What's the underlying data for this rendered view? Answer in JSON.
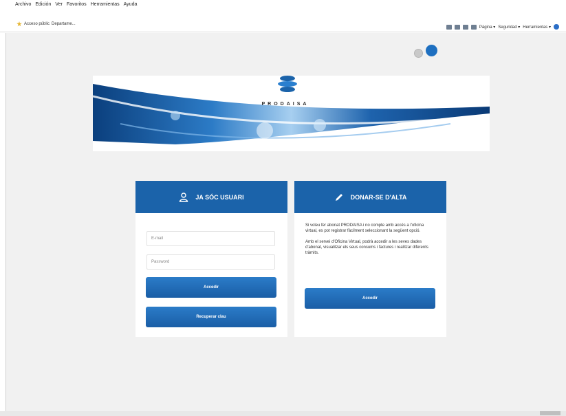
{
  "browser": {
    "menu": [
      "Archivo",
      "Edición",
      "Ver",
      "Favoritos",
      "Herramientas",
      "Ayuda"
    ],
    "favorites": [
      "Acceso públic",
      "Departame..."
    ],
    "toolbar": [
      "Página ▾",
      "Seguridad ▾",
      "Herramientas ▾"
    ]
  },
  "header": {
    "brand": "PRODAISA"
  },
  "login_card": {
    "title": "JA SÓC USUARI",
    "email_placeholder": "E-mail",
    "password_placeholder": "Password",
    "submit_label": "Accedir",
    "recover_label": "Recuperar clau"
  },
  "signup_card": {
    "title": "DONAR-SE D'ALTA",
    "text_1": "Si voleu fer abonat PRODAISA i no compte amb accés a l'oficina virtual, es pot registrar fàcilment seleccionant la següent opció.",
    "text_2": "Amb el servei d'Oficina Virtual, podrà accedir a les seves dades d'abonat, visualitzar els seus consums i factures i realitzar diferents tràmits.",
    "submit_label": "Accedir"
  },
  "colors": {
    "accent": "#1b63aa",
    "background": "#f1f1f1"
  }
}
